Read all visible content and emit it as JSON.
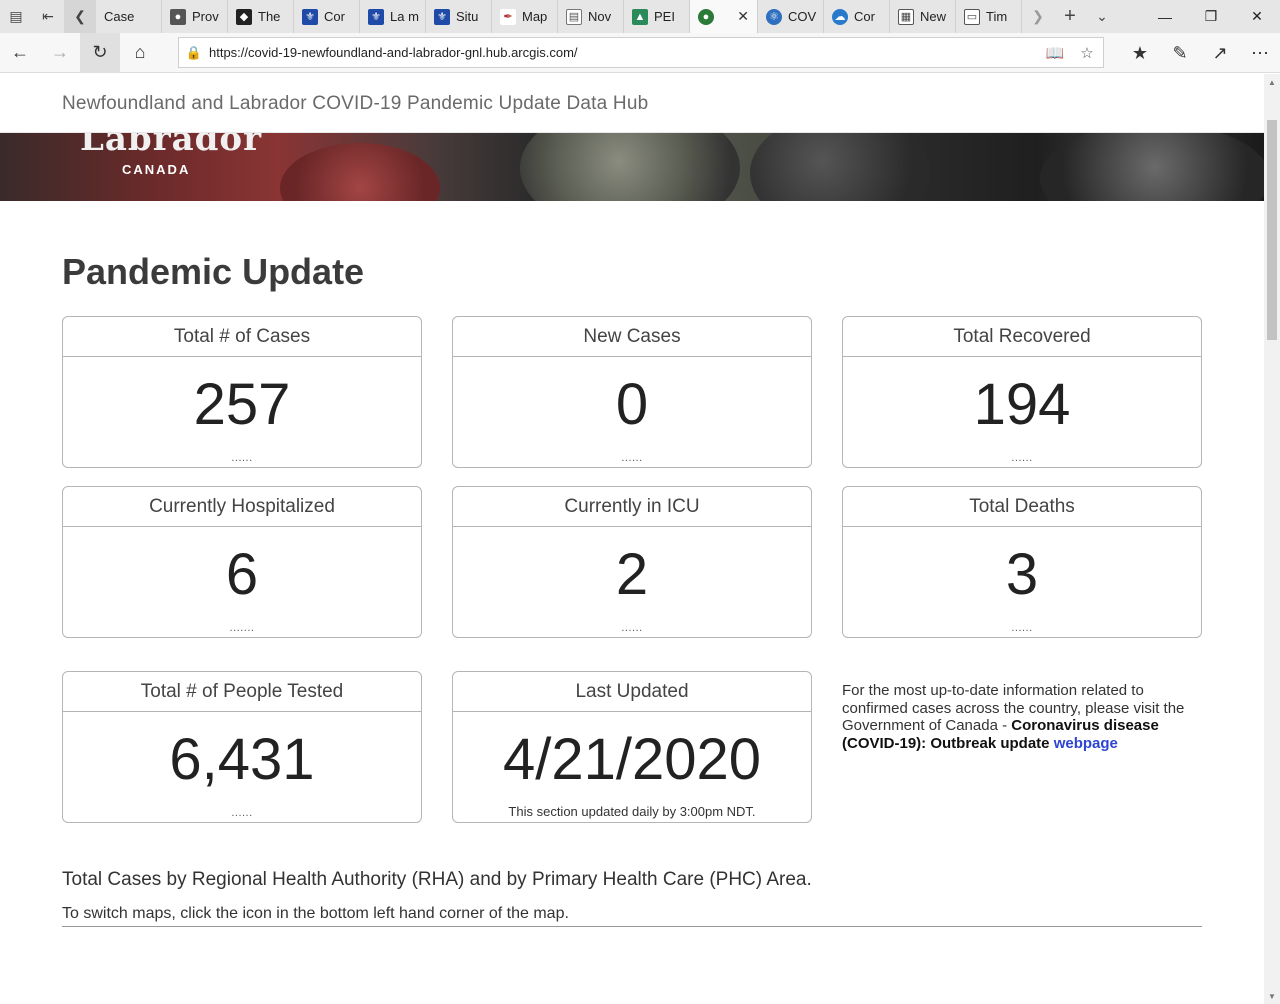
{
  "browser": {
    "tabs": [
      {
        "label": "Case",
        "icon": "page-icon",
        "color": "#666666"
      },
      {
        "label": "Prov",
        "icon": "bison-icon",
        "color": "#444444"
      },
      {
        "label": "The",
        "icon": "shield-icon",
        "color": "#222222"
      },
      {
        "label": "Cor",
        "icon": "fleur-de-lis-icon",
        "color": "#1f4aa8"
      },
      {
        "label": "La m",
        "icon": "fleur-de-lis-icon",
        "color": "#1f4aa8"
      },
      {
        "label": "Situ",
        "icon": "fleur-de-lis-icon",
        "color": "#1f4aa8"
      },
      {
        "label": "Map",
        "icon": "pen-icon",
        "color": "#b2302a"
      },
      {
        "label": "Nov",
        "icon": "newspaper-icon",
        "color": "#555555"
      },
      {
        "label": "PEI",
        "icon": "pei-icon",
        "color": "#2a8a5a"
      },
      {
        "label": "",
        "icon": "globe-icon",
        "color": "#2b7a3a",
        "active": true
      },
      {
        "label": "COV",
        "icon": "atom-icon",
        "color": "#2f6fbf"
      },
      {
        "label": "Cor",
        "icon": "cloud-icon",
        "color": "#2a7acb"
      },
      {
        "label": "New",
        "icon": "news-icon",
        "color": "#444444"
      },
      {
        "label": "Tim",
        "icon": "window-icon",
        "color": "#444444"
      }
    ],
    "url": "https://covid-19-newfoundland-and-labrador-gnl.hub.arcgis.com/"
  },
  "site": {
    "title": "Newfoundland and Labrador COVID-19 Pandemic Update Data Hub",
    "logo_text": "Labrador",
    "logo_sub": "CANADA"
  },
  "page": {
    "heading": "Pandemic Update",
    "cards": [
      {
        "label": "Total # of Cases",
        "value": "257",
        "foot": "......"
      },
      {
        "label": "New Cases",
        "value": "0",
        "foot": "......"
      },
      {
        "label": "Total Recovered",
        "value": "194",
        "foot": "......"
      },
      {
        "label": "Currently Hospitalized",
        "value": "6",
        "foot": "......."
      },
      {
        "label": "Currently in ICU",
        "value": "2",
        "foot": "......"
      },
      {
        "label": "Total Deaths",
        "value": "3",
        "foot": "......"
      },
      {
        "label": "Total # of People Tested",
        "value": "6,431",
        "foot": "......"
      },
      {
        "label": "Last Updated",
        "value": "4/21/2020",
        "note": "This section updated daily by 3:00pm NDT."
      }
    ],
    "info": {
      "text": "For the most up-to-date information related to confirmed cases across the country, please visit the Government of Canada - ",
      "bold": "Coronavirus disease (COVID-19): Outbreak update",
      "link": "webpage"
    },
    "section_title": "Total Cases by Regional Health Authority (RHA) and by Primary Health Care (PHC) Area.",
    "section_note": "To switch maps, click the icon in the bottom left hand corner of the map."
  }
}
